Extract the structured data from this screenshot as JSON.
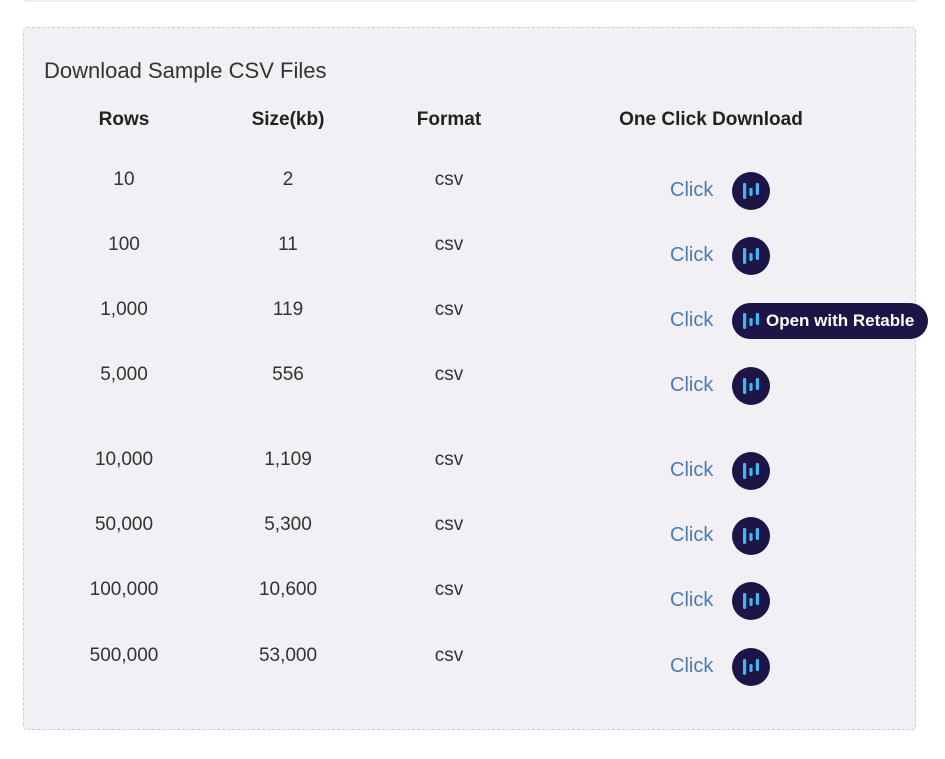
{
  "panel": {
    "title": "Download Sample CSV Files"
  },
  "table": {
    "headers": [
      "Rows",
      "Size(kb)",
      "Format",
      "One Click Download"
    ],
    "rows": [
      {
        "rows": "10",
        "size": "2",
        "format": "csv",
        "link": "Click"
      },
      {
        "rows": "100",
        "size": "11",
        "format": "csv",
        "link": "Click"
      },
      {
        "rows": "1,000",
        "size": "119",
        "format": "csv",
        "link": "Click"
      },
      {
        "rows": "5,000",
        "size": "556",
        "format": "csv",
        "link": "Click"
      },
      {
        "rows": "10,000",
        "size": "1,109",
        "format": "csv",
        "link": "Click"
      },
      {
        "rows": "50,000",
        "size": "5,300",
        "format": "csv",
        "link": "Click"
      },
      {
        "rows": "100,000",
        "size": "10,600",
        "format": "csv",
        "link": "Click"
      },
      {
        "rows": "500,000",
        "size": "53,000",
        "format": "csv",
        "link": "Click"
      }
    ]
  },
  "retable_button": {
    "label": "Open with Retable",
    "icon": "retable-logo-icon",
    "expanded_row": 2
  },
  "colors": {
    "panel_bg": "#f3f0f5",
    "link": "#4a7bb5",
    "button_bg": "#1c1545",
    "logo_bars": "#3fb8f5"
  }
}
